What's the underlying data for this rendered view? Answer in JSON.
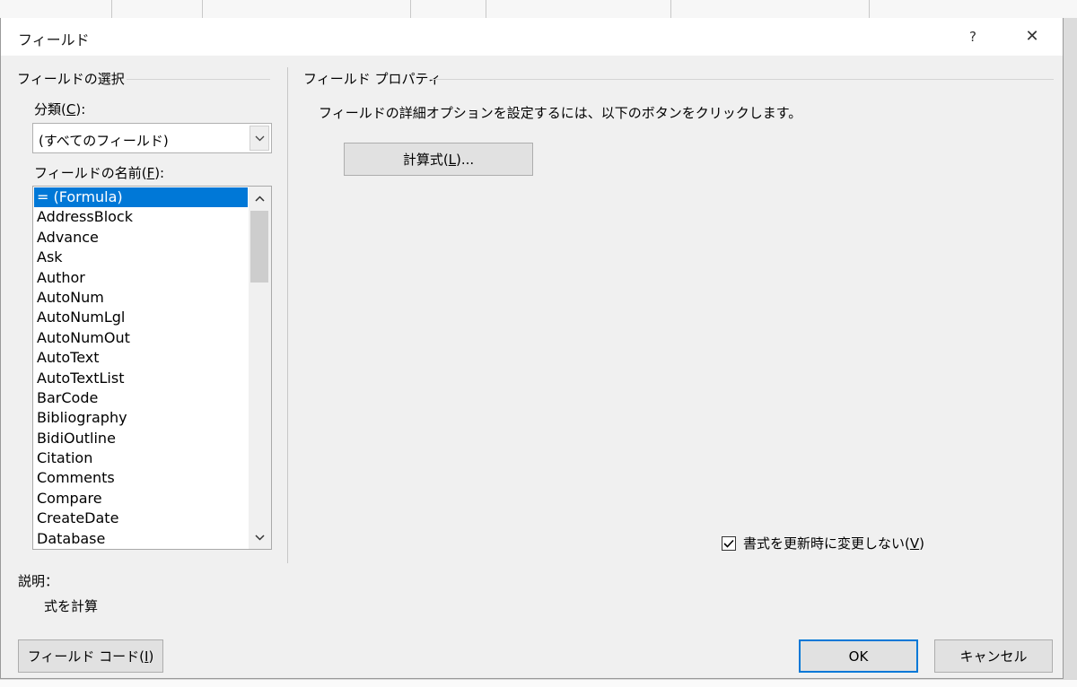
{
  "dialog": {
    "title": "フィールド",
    "help_glyph": "?",
    "close_glyph": "✕"
  },
  "left": {
    "group_title": "フィールドの選択",
    "category_label": "分類(",
    "category_key": "C",
    "category_label_end": "):",
    "category_value": "(すべてのフィールド)",
    "names_label": "フィールドの名前(",
    "names_key": "F",
    "names_label_end": "):",
    "field_names": [
      "= (Formula)",
      "AddressBlock",
      "Advance",
      "Ask",
      "Author",
      "AutoNum",
      "AutoNumLgl",
      "AutoNumOut",
      "AutoText",
      "AutoTextList",
      "BarCode",
      "Bibliography",
      "BidiOutline",
      "Citation",
      "Comments",
      "Compare",
      "CreateDate",
      "Database"
    ],
    "selected_index": 0
  },
  "right": {
    "group_title": "フィールド プロパティ",
    "instruction": "フィールドの詳細オプションを設定するには、以下のボタンをクリックします。",
    "formula_btn": "計算式(",
    "formula_key": "L",
    "formula_btn_end": ")...",
    "preserve_label": "書式を更新時に変更しない(",
    "preserve_key": "V",
    "preserve_label_end": ")",
    "preserve_checked": true
  },
  "description": {
    "label": "説明：",
    "text": "式を計算"
  },
  "footer": {
    "field_codes_btn": "フィールド コード(",
    "field_codes_key": "I",
    "field_codes_btn_end": ")",
    "ok": "OK",
    "cancel": "キャンセル"
  }
}
